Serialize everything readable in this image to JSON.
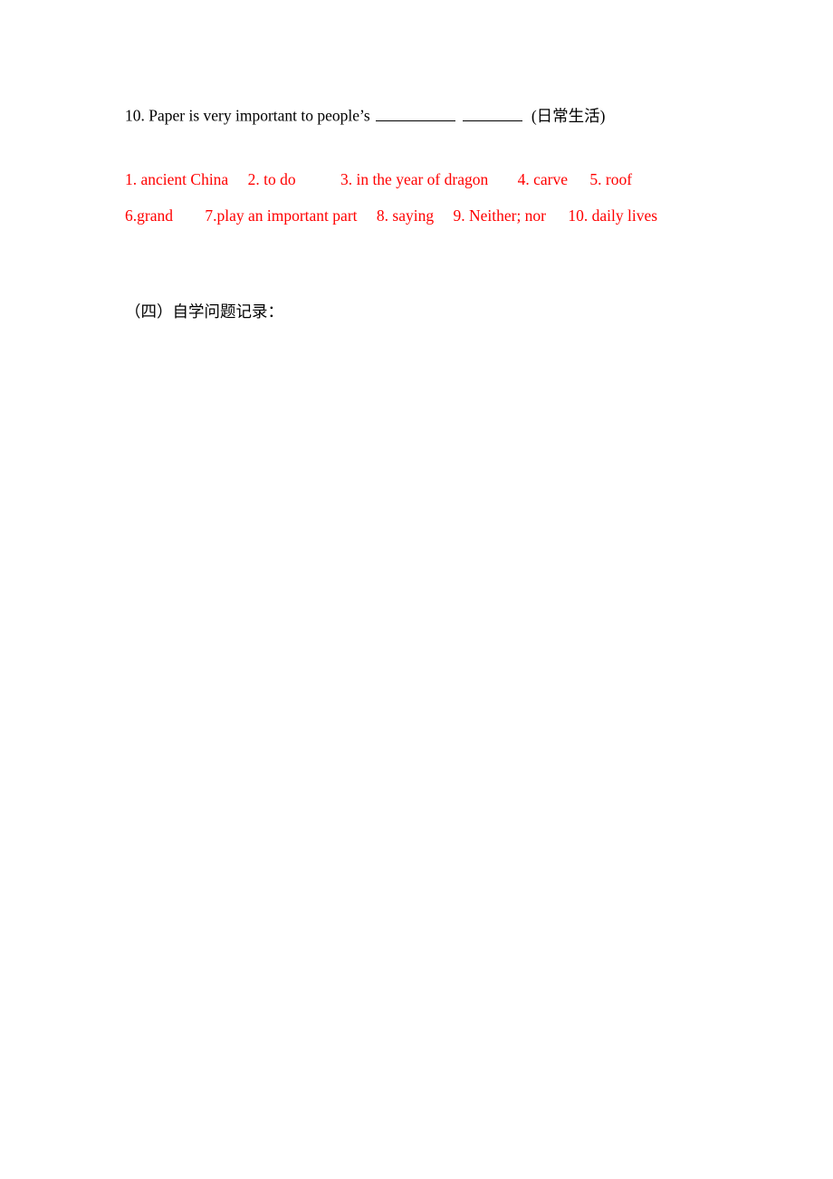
{
  "document": {
    "background_color": "#ffffff",
    "text_color": "#000000",
    "answer_key_color": "#ff0000"
  },
  "question": {
    "number": "10.",
    "text_before_blanks": "Paper is very important to people’s",
    "blank_1": "",
    "blank_2": "",
    "hint": "(日常生活)"
  },
  "answer_key": {
    "row_1": [
      {
        "label": "1. ancient China"
      },
      {
        "label": "2. to do"
      },
      {
        "label": "3. in the year of dragon"
      },
      {
        "label": "4. carve"
      },
      {
        "label": "5. roof"
      }
    ],
    "row_2": [
      {
        "label": "6.grand"
      },
      {
        "label": "7.play an important part"
      },
      {
        "label": "8. saying"
      },
      {
        "label": "9. Neither; nor"
      },
      {
        "label": "10. daily lives"
      }
    ]
  },
  "section": {
    "heading": "（四）自学问题记录："
  }
}
